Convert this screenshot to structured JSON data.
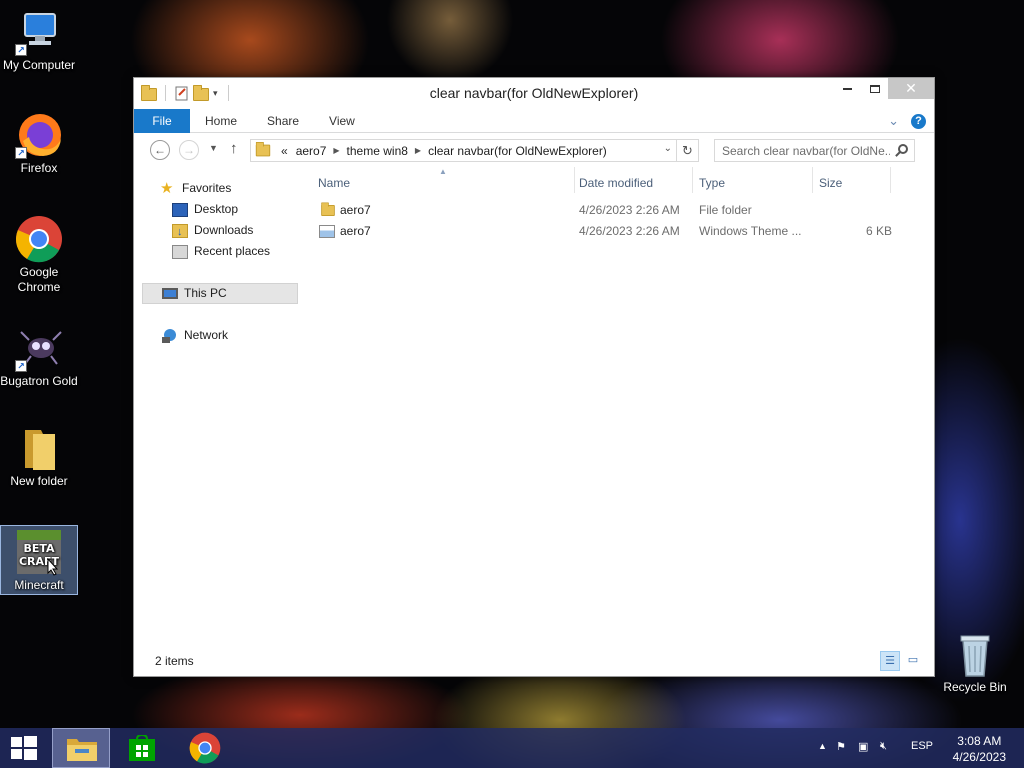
{
  "desktop": {
    "icons": [
      {
        "label": "My Computer"
      },
      {
        "label": "Firefox"
      },
      {
        "label": "Google Chrome"
      },
      {
        "label": "Bugatron Gold"
      },
      {
        "label": "New folder"
      },
      {
        "label": "Minecraft",
        "logo_text": "BETA CRAFT"
      },
      {
        "label": "Recycle Bin"
      }
    ]
  },
  "window": {
    "title": "clear navbar(for OldNewExplorer)",
    "ribbon": {
      "tabs": [
        "File",
        "Home",
        "Share",
        "View"
      ],
      "help_label": "?"
    },
    "address": {
      "overflow": "«",
      "breadcrumbs": [
        "aero7",
        "theme win8",
        "clear navbar(for OldNewExplorer)"
      ]
    },
    "search": {
      "placeholder": "Search clear navbar(for OldNe..."
    },
    "nav_pane": {
      "favorites_label": "Favorites",
      "favorites": [
        "Desktop",
        "Downloads",
        "Recent places"
      ],
      "this_pc_label": "This PC",
      "network_label": "Network"
    },
    "columns": [
      "Name",
      "Date modified",
      "Type",
      "Size"
    ],
    "files": [
      {
        "icon": "folder-icon",
        "name": "aero7",
        "date": "4/26/2023 2:26 AM",
        "type": "File folder",
        "size": ""
      },
      {
        "icon": "theme-file-icon",
        "name": "aero7",
        "date": "4/26/2023 2:26 AM",
        "type": "Windows Theme ...",
        "size": "6 KB"
      }
    ],
    "status": {
      "item_count": "2 items"
    }
  },
  "taskbar": {
    "apps": [
      "file-explorer-icon",
      "store-icon",
      "chrome-icon"
    ],
    "tray": {
      "language": "ESP",
      "time": "3:08 AM",
      "date": "4/26/2023"
    }
  },
  "colors": {
    "accent": "#1979ca",
    "taskbar": "#222c60",
    "folder": "#e8c154"
  }
}
